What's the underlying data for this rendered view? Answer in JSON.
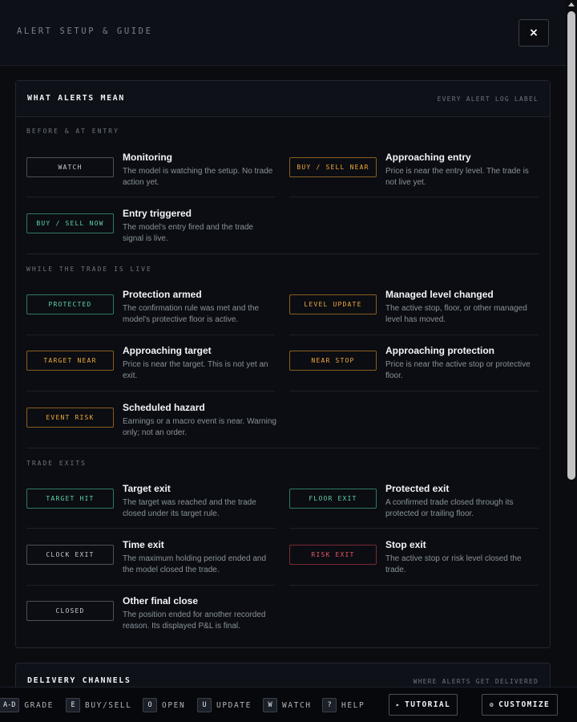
{
  "header": {
    "title": "ALERT SETUP & GUIDE",
    "close_label": "×"
  },
  "alerts_card": {
    "title": "WHAT ALERTS MEAN",
    "subtitle": "EVERY ALERT LOG LABEL",
    "sections": [
      {
        "label": "BEFORE & AT ENTRY",
        "items": [
          {
            "badge": "WATCH",
            "tone": "neutral",
            "name": "Monitoring",
            "desc": "The model is watching the setup. No trade action yet."
          },
          {
            "badge": "BUY / SELL NEAR",
            "tone": "amber",
            "name": "Approaching entry",
            "desc": "Price is near the entry level. The trade is not live yet."
          },
          {
            "badge": "BUY / SELL NOW",
            "tone": "green",
            "name": "Entry triggered",
            "desc": "The model's entry fired and the trade signal is live."
          }
        ]
      },
      {
        "label": "WHILE THE TRADE IS LIVE",
        "items": [
          {
            "badge": "PROTECTED",
            "tone": "green",
            "name": "Protection armed",
            "desc": "The confirmation rule was met and the model's protective floor is active."
          },
          {
            "badge": "LEVEL UPDATE",
            "tone": "amber",
            "name": "Managed level changed",
            "desc": "The active stop, floor, or other managed level has moved."
          },
          {
            "badge": "TARGET NEAR",
            "tone": "amber",
            "name": "Approaching target",
            "desc": "Price is near the target. This is not yet an exit."
          },
          {
            "badge": "NEAR STOP",
            "tone": "amber",
            "name": "Approaching protection",
            "desc": "Price is near the active stop or protective floor."
          },
          {
            "badge": "EVENT RISK",
            "tone": "amber",
            "name": "Scheduled hazard",
            "desc": "Earnings or a macro event is near. Warning only; not an order."
          }
        ]
      },
      {
        "label": "TRADE EXITS",
        "items": [
          {
            "badge": "TARGET HIT",
            "tone": "green",
            "name": "Target exit",
            "desc": "The target was reached and the trade closed under its target rule."
          },
          {
            "badge": "FLOOR EXIT",
            "tone": "green",
            "name": "Protected exit",
            "desc": "A confirmed trade closed through its protected or trailing floor."
          },
          {
            "badge": "CLOCK EXIT",
            "tone": "neutral",
            "name": "Time exit",
            "desc": "The maximum holding period ended and the model closed the trade."
          },
          {
            "badge": "RISK EXIT",
            "tone": "red",
            "name": "Stop exit",
            "desc": "The active stop or risk level closed the trade."
          },
          {
            "badge": "CLOSED",
            "tone": "neutral",
            "name": "Other final close",
            "desc": "The position ended for another recorded reason. Its displayed P&L is final."
          }
        ]
      }
    ]
  },
  "delivery_card": {
    "title": "DELIVERY CHANNELS",
    "subtitle": "WHERE ALERTS GET DELIVERED"
  },
  "shortcuts": [
    {
      "key": "A-D",
      "label": "GRADE"
    },
    {
      "key": "E",
      "label": "BUY/SELL"
    },
    {
      "key": "O",
      "label": "OPEN"
    },
    {
      "key": "U",
      "label": "UPDATE"
    },
    {
      "key": "W",
      "label": "WATCH"
    },
    {
      "key": "?",
      "label": "HELP"
    }
  ],
  "bottom_buttons": {
    "tutorial": "TUTORIAL",
    "customize": "CUSTOMIZE"
  },
  "icons": {
    "tutorial": "play-icon",
    "customize": "gear-icon"
  },
  "colors": {
    "background": "#0a0c10",
    "green": "#5fd3a8",
    "amber": "#f0a83c",
    "red": "#e8576a"
  }
}
